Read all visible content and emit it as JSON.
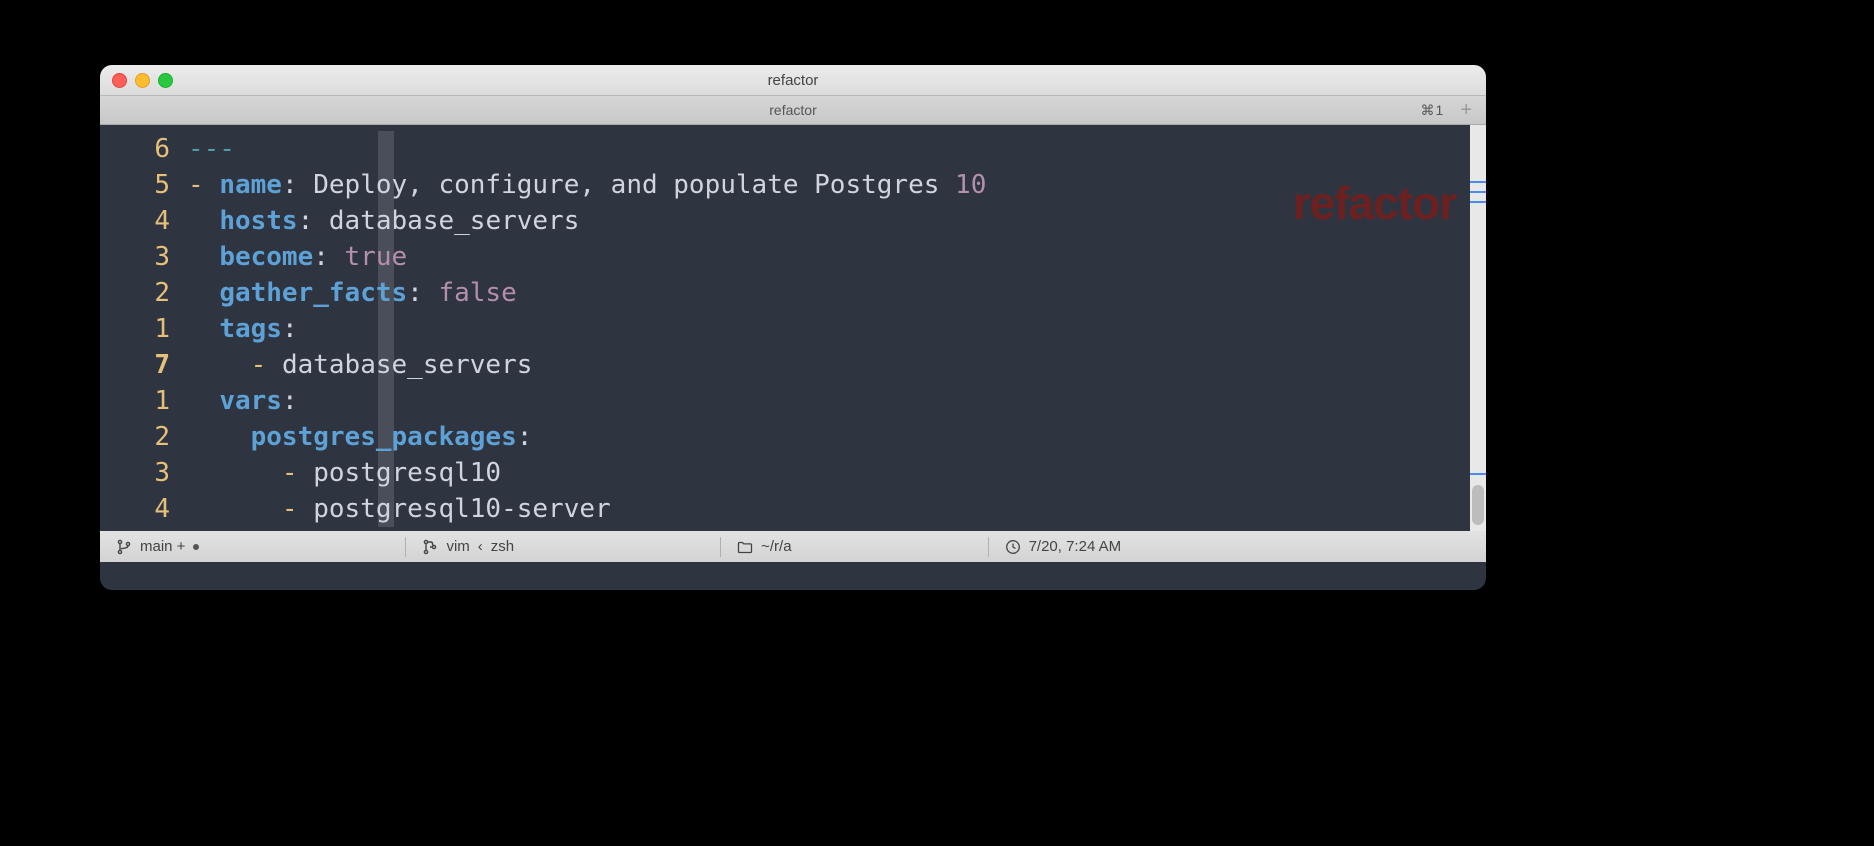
{
  "window": {
    "title": "refactor",
    "tab_label": "refactor",
    "tab_shortcut": "⌘1",
    "watermark": "refactor"
  },
  "gutter": [
    "6",
    "5",
    "4",
    "3",
    "2",
    "1",
    "7",
    "1",
    "2",
    "3",
    "4"
  ],
  "code": {
    "l0": "---",
    "l1_dash": "- ",
    "l1_key": "name",
    "l1_colon": ": ",
    "l1_val": "Deploy, configure, and populate Postgres ",
    "l1_num": "10",
    "l2_key": "hosts",
    "l2_colon": ": ",
    "l2_val": "database_servers",
    "l3_key": "become",
    "l3_colon": ": ",
    "l3_val": "true",
    "l4_key": "gather_facts",
    "l4_colon": ": ",
    "l4_val": "false",
    "l5_key": "tags",
    "l5_colon": ":",
    "l6_dash": "- ",
    "l6_val": "database_servers",
    "l7_key": "vars",
    "l7_colon": ":",
    "l8_key": "postgres_packages",
    "l8_colon": ":",
    "l9_dash": "- ",
    "l9_val": "postgresql10",
    "l10_dash": "- ",
    "l10_val": "postgresql10-server"
  },
  "status": {
    "branch": "main + ",
    "proc1": "vim",
    "proc_sep": "‹",
    "proc2": "zsh",
    "cwd": "~/r/a",
    "time": "7/20, 7:24 AM"
  }
}
